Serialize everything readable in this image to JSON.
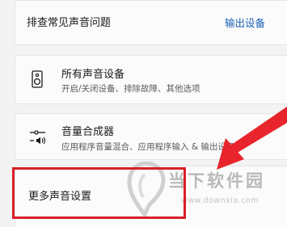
{
  "troubleshoot": {
    "title": "排查常见声音问题",
    "link": "输出设备"
  },
  "all_devices": {
    "title": "所有声音设备",
    "subtitle": "开启/关闭设备、排除故障、其他选项",
    "icon": "speaker-icon"
  },
  "mixer": {
    "title": "音量合成器",
    "subtitle": "应用程序音量混合、应用程序输入 & 输出设备",
    "icon": "volume-mixer-icon"
  },
  "more_settings": {
    "title": "更多声音设置"
  },
  "annotation": {
    "highlight_color": "#d91f26",
    "arrow": "red-arrow"
  },
  "watermark": {
    "brand": "当下软件园",
    "url": "www.downxia.com"
  },
  "colors": {
    "background": "#f3f3f3",
    "card": "#fbfbfb",
    "link": "#1a5fb4",
    "subtitle": "#5a5a5a"
  }
}
